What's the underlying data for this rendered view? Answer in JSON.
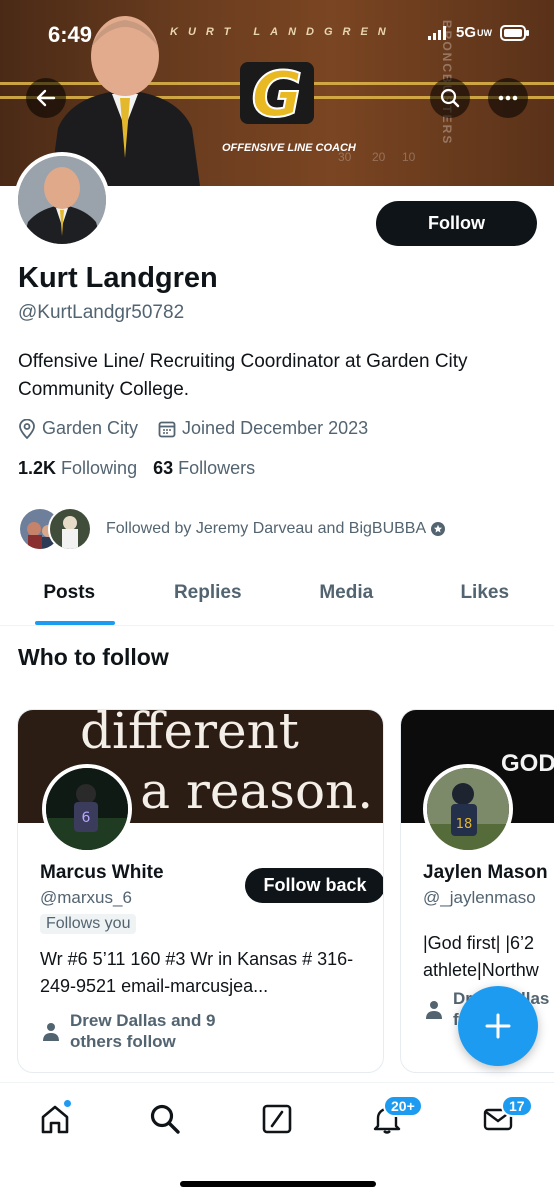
{
  "status_bar": {
    "time": "6:49",
    "network": "5G",
    "network_sub": "UW"
  },
  "banner": {
    "name_text": "KURT LANDGREN",
    "logo_letter": "G",
    "caption": "OFFENSIVE LINE COACH",
    "side_text": "BRONCBUSTERS",
    "yard_numbers": [
      "30",
      "20",
      "10"
    ]
  },
  "profile": {
    "name": "Kurt Landgren",
    "handle": "@KurtLandgr50782",
    "bio": "Offensive Line/ Recruiting Coordinator at Garden City Community College.",
    "location": "Garden City",
    "joined": "Joined December 2023",
    "following_count": "1.2K",
    "following_label": "Following",
    "followers_count": "63",
    "followers_label": "Followers",
    "followed_by": "Followed by Jeremy Darveau and BigBUBBA",
    "follow_button": "Follow"
  },
  "tabs": [
    "Posts",
    "Replies",
    "Media",
    "Likes"
  ],
  "who_to_follow": {
    "title": "Who to follow",
    "cards": [
      {
        "banner_text_1": "different",
        "banner_text_2": "f  a reason.",
        "name": "Marcus White",
        "handle": "@marxus_6",
        "badge": "Follows you",
        "bio": "Wr #6 5’11 160 #3 Wr in Kansas # 316-249-9521 email-marcusjea...",
        "social": "Drew Dallas and 9 others follow",
        "button": "Follow back"
      },
      {
        "banner_text_1": "GOD",
        "name": "Jaylen Mason",
        "handle": "@_jaylenmaso",
        "bio": "|God first| |6’2 athlete|Northw",
        "social": "Drew Dallas o follow"
      }
    ]
  },
  "bottom_nav": {
    "notifications_badge": "20+",
    "messages_badge": "17"
  },
  "colors": {
    "accent": "#1d9bf0",
    "text": "#0f1419",
    "secondary": "#536471"
  }
}
